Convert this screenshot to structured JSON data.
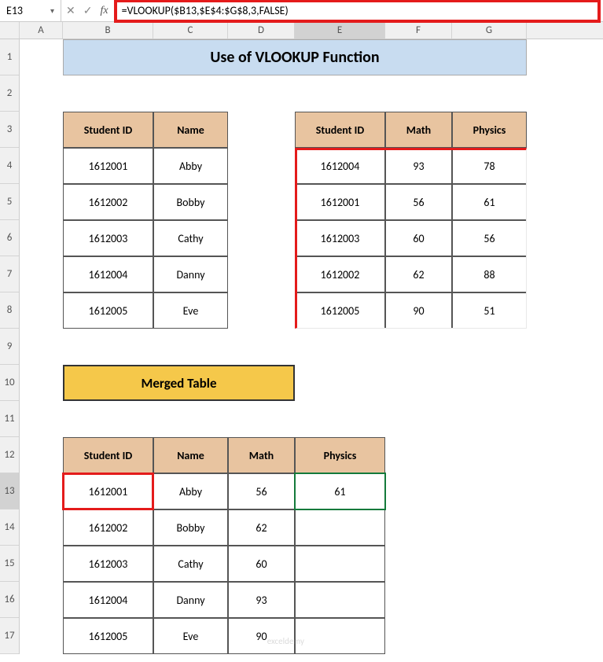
{
  "nameBox": "E13",
  "formula": "=VLOOKUP($B13,$E$4:$G$8,3,FALSE)",
  "columns": [
    "",
    "A",
    "B",
    "C",
    "D",
    "E",
    "F",
    "G"
  ],
  "rows": [
    "1",
    "2",
    "3",
    "4",
    "5",
    "6",
    "7",
    "8",
    "9",
    "10",
    "11",
    "12",
    "13",
    "14",
    "15",
    "16",
    "17"
  ],
  "title": "Use of VLOOKUP Function",
  "mergedTitle": "Merged Table",
  "table1": {
    "headers": [
      "Student ID",
      "Name"
    ],
    "rows": [
      [
        "1612001",
        "Abby"
      ],
      [
        "1612002",
        "Bobby"
      ],
      [
        "1612003",
        "Cathy"
      ],
      [
        "1612004",
        "Danny"
      ],
      [
        "1612005",
        "Eve"
      ]
    ]
  },
  "table2": {
    "headers": [
      "Student ID",
      "Math",
      "Physics"
    ],
    "rows": [
      [
        "1612004",
        "93",
        "78"
      ],
      [
        "1612001",
        "56",
        "61"
      ],
      [
        "1612003",
        "60",
        "56"
      ],
      [
        "1612002",
        "62",
        "88"
      ],
      [
        "1612005",
        "90",
        "51"
      ]
    ]
  },
  "table3": {
    "headers": [
      "Student ID",
      "Name",
      "Math",
      "Physics"
    ],
    "rows": [
      [
        "1612001",
        "Abby",
        "56",
        "61"
      ],
      [
        "1612002",
        "Bobby",
        "62",
        ""
      ],
      [
        "1612003",
        "Cathy",
        "60",
        ""
      ],
      [
        "1612004",
        "Danny",
        "93",
        ""
      ],
      [
        "1612005",
        "Eve",
        "90",
        ""
      ]
    ]
  },
  "watermark": "exceldemy"
}
